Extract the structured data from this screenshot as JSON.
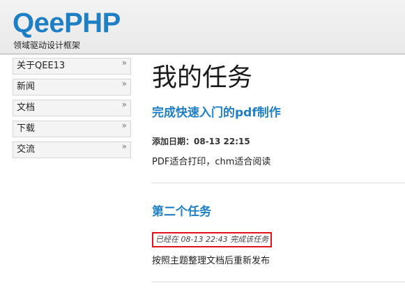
{
  "header": {
    "logo": "QeePHP",
    "tagline": "领域驱动设计框架"
  },
  "sidebar": {
    "items": [
      {
        "label": "关于QEE13",
        "chevron": "»"
      },
      {
        "label": "新闻",
        "chevron": "»"
      },
      {
        "label": "文档",
        "chevron": "»"
      },
      {
        "label": "下载",
        "chevron": "»"
      },
      {
        "label": "交流",
        "chevron": "»"
      }
    ]
  },
  "main": {
    "title": "我的任务",
    "tasks": [
      {
        "title": "完成快速入门的pdf制作",
        "meta": "添加日期：08-13 22:15",
        "description": "PDF适合打印，chm适合阅读"
      },
      {
        "title": "第二个任务",
        "meta": "已经在 08-13 22:43 完成该任务",
        "description": "按照主题整理文档后重新发布"
      }
    ]
  },
  "colors": {
    "brand": "#1f7fc4",
    "highlight_border": "#e1141c"
  }
}
